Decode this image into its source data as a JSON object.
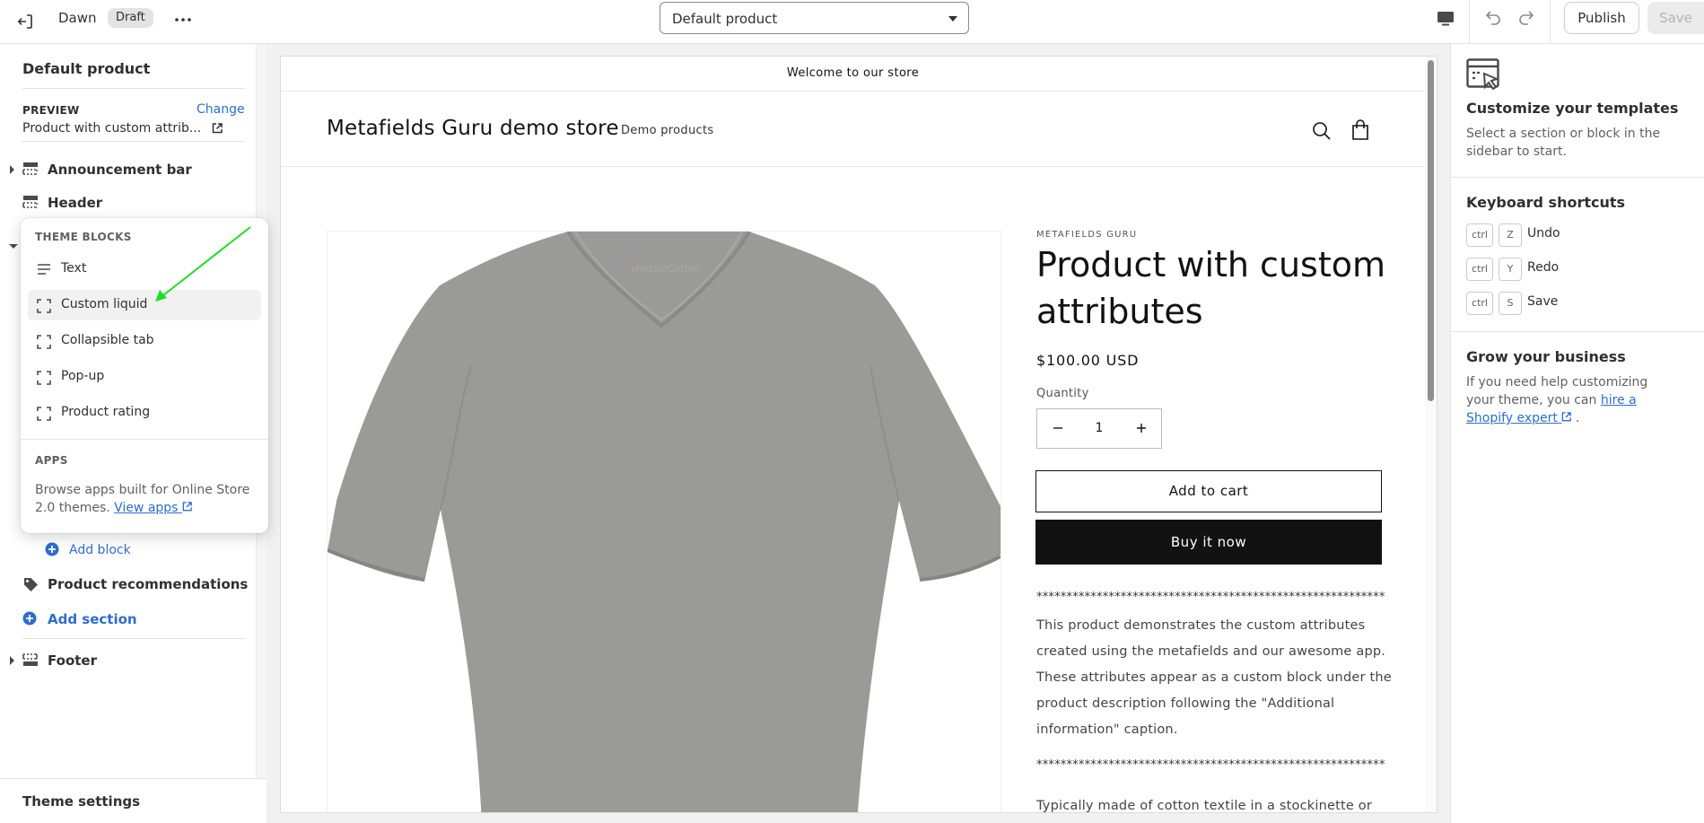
{
  "topbar": {
    "theme_name": "Dawn",
    "badge": "Draft",
    "template_select": "Default product",
    "publish_label": "Publish",
    "save_label": "Save"
  },
  "sidebar": {
    "title": "Default product",
    "preview_label": "PREVIEW",
    "change_label": "Change",
    "preview_value": "Product with custom attrib...",
    "sections": [
      {
        "label": "Announcement bar"
      },
      {
        "label": "Header"
      },
      {
        "label": "Product recommendations"
      },
      {
        "label": "Footer"
      }
    ],
    "add_block_label": "Add block",
    "add_section_label": "Add section",
    "theme_settings_label": "Theme settings"
  },
  "popover": {
    "theme_blocks_heading": "THEME BLOCKS",
    "items": [
      {
        "label": "Text",
        "icon": "text-icon"
      },
      {
        "label": "Custom liquid",
        "icon": "block-icon"
      },
      {
        "label": "Collapsible tab",
        "icon": "block-icon"
      },
      {
        "label": "Pop-up",
        "icon": "block-icon"
      },
      {
        "label": "Product rating",
        "icon": "block-icon"
      }
    ],
    "apps_heading": "APPS",
    "apps_desc": "Browse apps built for Online Store 2.0 themes.",
    "view_apps_label": "View apps",
    "annotation_color": "#22dd22"
  },
  "preview": {
    "announcement": "Welcome to our store",
    "store_name": "Metafields Guru demo store",
    "nav_item": "Demo products",
    "vendor": "METAFIELDS GURU",
    "product_title": "Product with custom attributes",
    "price": "$100.00 USD",
    "quantity_label": "Quantity",
    "quantity_value": "1",
    "add_to_cart": "Add to cart",
    "buy_now": "Buy it now",
    "separator": "**********************************************************",
    "description": "This product demonstrates the custom attributes created using the metafields and our awesome app. These attributes appear as a custom block under the product description following the \"Additional information\" caption.",
    "description_2": "Typically made of cotton textile in a stockinette or",
    "tshirt_brand": "shirtsofCotton",
    "tshirt_color": "#9a9a98"
  },
  "right_panel": {
    "title": "Customize your templates",
    "text": "Select a section or block in the sidebar to start.",
    "shortcuts_title": "Keyboard shortcuts",
    "shortcuts": [
      {
        "mod": "ctrl",
        "key": "Z",
        "label": "Undo"
      },
      {
        "mod": "ctrl",
        "key": "Y",
        "label": "Redo"
      },
      {
        "mod": "ctrl",
        "key": "S",
        "label": "Save"
      }
    ],
    "grow_title": "Grow your business",
    "grow_text": "If you need help customizing your theme, you can",
    "grow_link": "hire a Shopify expert",
    "grow_end": "."
  }
}
